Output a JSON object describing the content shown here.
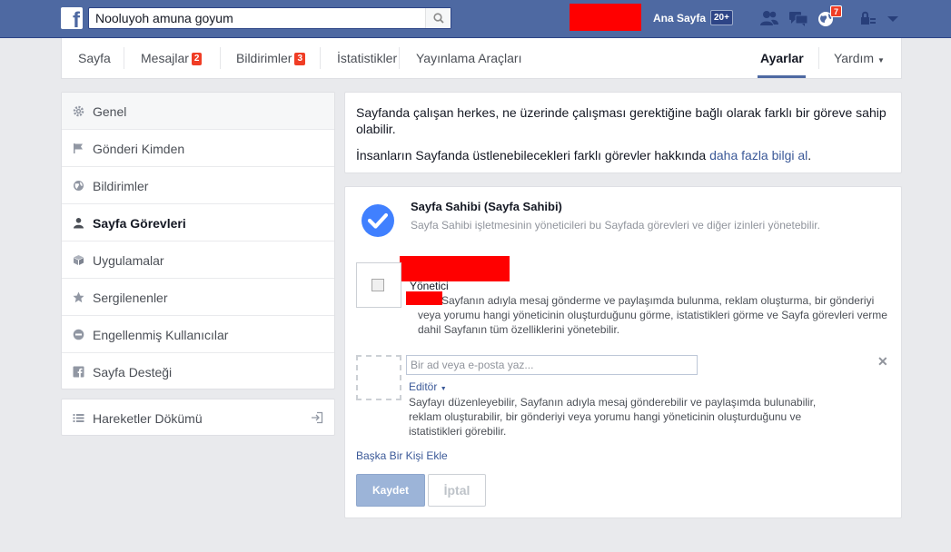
{
  "topbar": {
    "logo": "f",
    "search_value": "Nooluyoh amuna goyum",
    "home_label": "Ana Sayfa",
    "home_badge": "20+",
    "notifications_badge": "7"
  },
  "pagenav": {
    "items": [
      {
        "label": "Sayfa"
      },
      {
        "label": "Mesajlar",
        "badge": "2"
      },
      {
        "label": "Bildirimler",
        "badge": "3"
      },
      {
        "label": "İstatistikler"
      },
      {
        "label": "Yayınlama Araçları"
      }
    ],
    "settings": "Ayarlar",
    "help": "Yardım"
  },
  "leftmenu": {
    "items": [
      {
        "label": "Genel",
        "icon": "gear-icon"
      },
      {
        "label": "Gönderi Kimden",
        "icon": "flag-icon"
      },
      {
        "label": "Bildirimler",
        "icon": "globe-icon"
      },
      {
        "label": "Sayfa Görevleri",
        "icon": "person-icon"
      },
      {
        "label": "Uygulamalar",
        "icon": "cube-icon"
      },
      {
        "label": "Sergilenenler",
        "icon": "star-icon"
      },
      {
        "label": "Engellenmiş Kullanıcılar",
        "icon": "block-icon"
      },
      {
        "label": "Sayfa Desteği",
        "icon": "facebook-icon"
      }
    ],
    "activity_log": "Hareketler Dökümü"
  },
  "info": {
    "line1": "Sayfanda çalışan herkes, ne üzerinde çalışması gerektiğine bağlı olarak farklı bir göreve sahip olabilir.",
    "line2_prefix": "İnsanların Sayfanda üstlenebilecekleri farklı görevler hakkında ",
    "line2_link": "daha fazla bilgi al",
    "line2_suffix": "."
  },
  "roles": {
    "owner_title": "Sayfa Sahibi (Sayfa Sahibi)",
    "owner_desc": "Sayfa Sahibi işletmesinin yöneticileri bu Sayfada görevleri ve diğer izinleri yönetebilir.",
    "admin_role": "Yönetici",
    "admin_desc": "Sayfanın adıyla mesaj gönderme ve paylaşımda bulunma, reklam oluşturma, bir gönderiyi veya yorumu hangi yöneticinin oluşturduğunu görme, istatistikleri görme ve Sayfa görevleri verme dahil Sayfanın tüm özelliklerini yönetebilir.",
    "input_placeholder": "Bir ad veya e-posta yaz...",
    "editor_label": "Editör",
    "editor_desc": "Sayfayı düzenleyebilir, Sayfanın adıyla mesaj gönderebilir ve paylaşımda bulunabilir, reklam oluşturabilir, bir gönderiyi veya yorumu hangi yöneticinin oluşturduğunu ve istatistikleri görebilir.",
    "add_person": "Başka Bir Kişi Ekle",
    "save": "Kaydet",
    "cancel": "İptal"
  }
}
